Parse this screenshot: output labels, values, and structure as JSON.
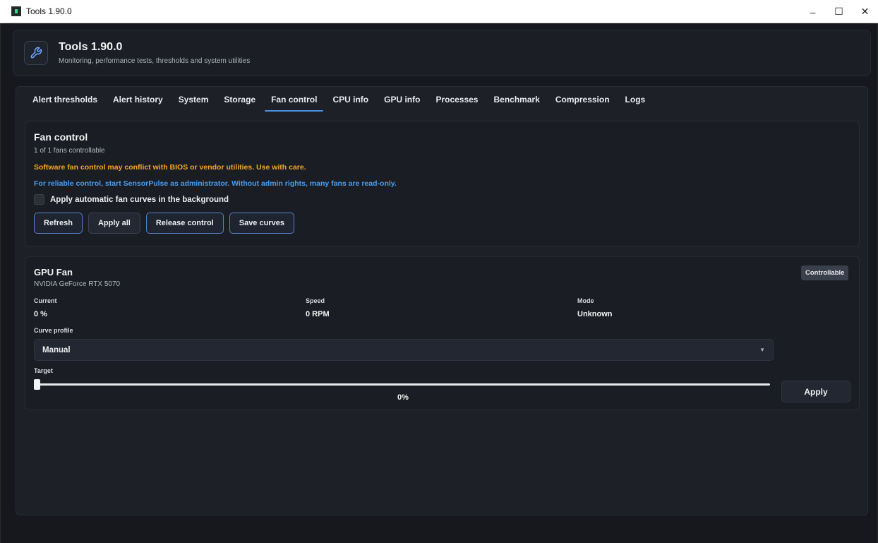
{
  "window": {
    "title": "Tools 1.90.0",
    "controls": {
      "minimize": "–",
      "maximize": "☐",
      "close": "✕"
    }
  },
  "header": {
    "title": "Tools 1.90.0",
    "subtitle": "Monitoring, performance tests, thresholds and system utilities",
    "icon": "wrench-icon"
  },
  "tabs": [
    {
      "label": "Alert thresholds"
    },
    {
      "label": "Alert history"
    },
    {
      "label": "System"
    },
    {
      "label": "Storage"
    },
    {
      "label": "Fan control",
      "active": true
    },
    {
      "label": "CPU info"
    },
    {
      "label": "GPU info"
    },
    {
      "label": "Processes"
    },
    {
      "label": "Benchmark"
    },
    {
      "label": "Compression"
    },
    {
      "label": "Logs"
    }
  ],
  "fan_control": {
    "title": "Fan control",
    "subtitle": "1 of 1 fans controllable",
    "warning": "Software fan control may conflict with BIOS or vendor utilities. Use with care.",
    "info": "For reliable control, start SensorPulse as administrator. Without admin rights, many fans are read-only.",
    "checkbox_label": "Apply automatic fan curves in the background",
    "checkbox_checked": false,
    "buttons": {
      "refresh": "Refresh",
      "apply_all": "Apply all",
      "release_control": "Release control",
      "save_curves": "Save curves"
    }
  },
  "gpu_fan": {
    "title": "GPU Fan",
    "device": "NVIDIA GeForce RTX 5070",
    "badge": "Controllable",
    "current_label": "Current",
    "current_value": "0 %",
    "speed_label": "Speed",
    "speed_value": "0 RPM",
    "mode_label": "Mode",
    "mode_value": "Unknown",
    "curve_label": "Curve profile",
    "curve_value": "Manual",
    "target_label": "Target",
    "target_value": "0%",
    "target_fraction": 0,
    "apply_label": "Apply"
  },
  "colors": {
    "warning": "#f5a623",
    "info": "#4a9ef0",
    "accent": "#4a90e2"
  }
}
